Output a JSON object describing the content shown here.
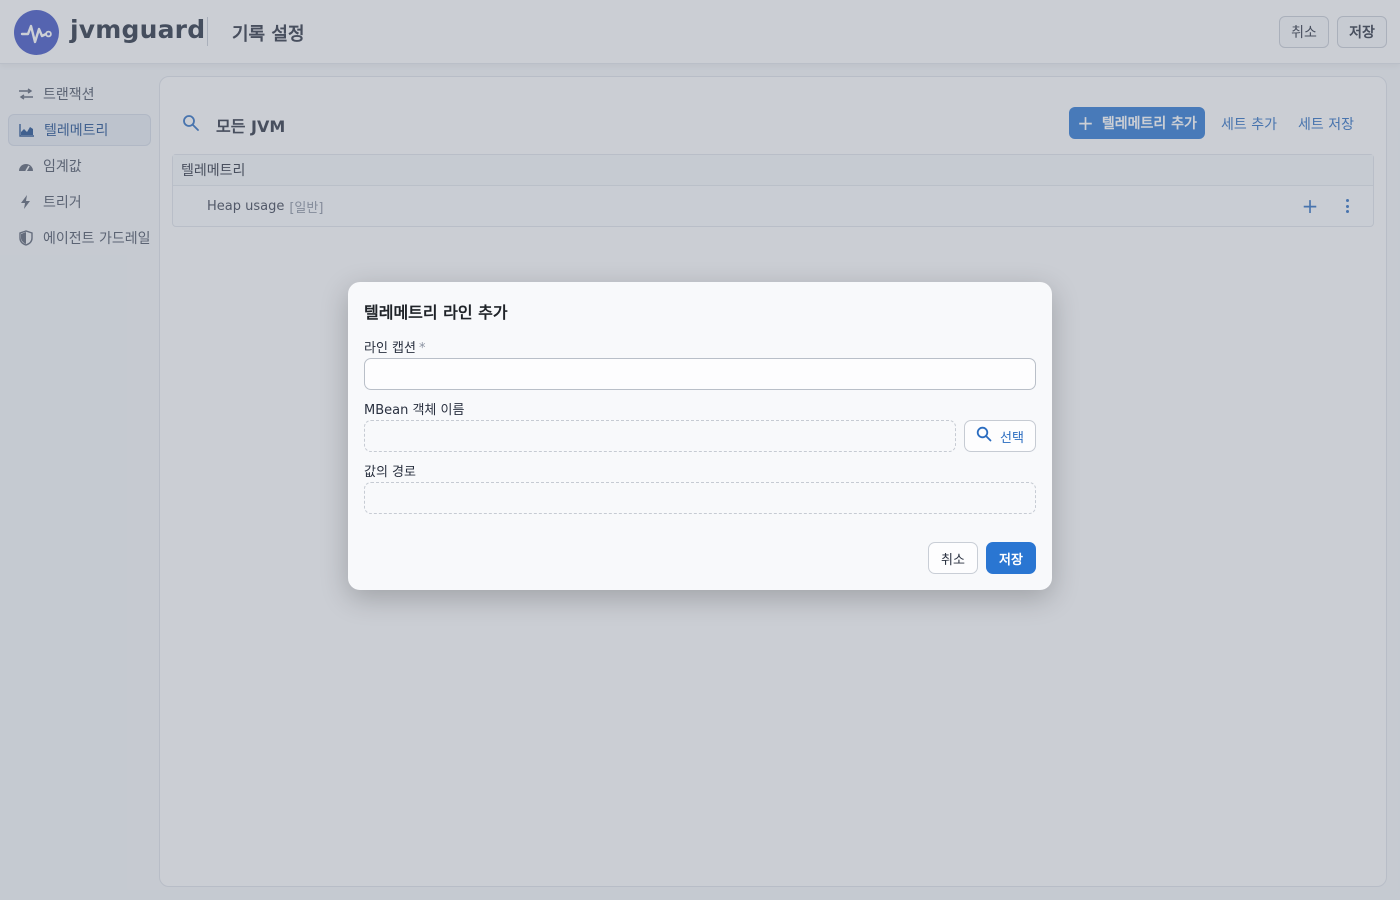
{
  "header": {
    "brand": "jvmguard",
    "title": "기록 설정",
    "cancel_label": "취소",
    "save_label": "저장",
    "logo_icon": "pulse-logo-icon",
    "accent_color": "#3f53c4"
  },
  "sidebar": {
    "items": [
      {
        "label": "트랜잭션",
        "icon": "transactions-icon",
        "active": false
      },
      {
        "label": "텔레메트리",
        "icon": "chart-icon",
        "active": true
      },
      {
        "label": "임계값",
        "icon": "gauge-icon",
        "active": false
      },
      {
        "label": "트리거",
        "icon": "lightning-icon",
        "active": false
      },
      {
        "label": "에이전트 가드레일",
        "icon": "shield-icon",
        "active": false
      }
    ]
  },
  "main": {
    "scope_title": "모든 JVM",
    "add_telemetry_label": "텔레메트리 추가",
    "add_set_label": "세트 추가",
    "save_set_label": "세트 저장",
    "table": {
      "header": "텔레메트리",
      "rows": [
        {
          "name": "Heap usage",
          "tag": "[일반]"
        }
      ]
    }
  },
  "dialog": {
    "title": "텔레메트리 라인 추가",
    "caption_label": "라인 캡션",
    "required_mark": "*",
    "caption_value": "",
    "mbean_label": "MBean 객체 이름",
    "mbean_value": "",
    "select_label": "선택",
    "path_label": "값의 경로",
    "path_value": "",
    "cancel_label": "취소",
    "save_label": "저장",
    "primary_color": "#2a76d2"
  }
}
